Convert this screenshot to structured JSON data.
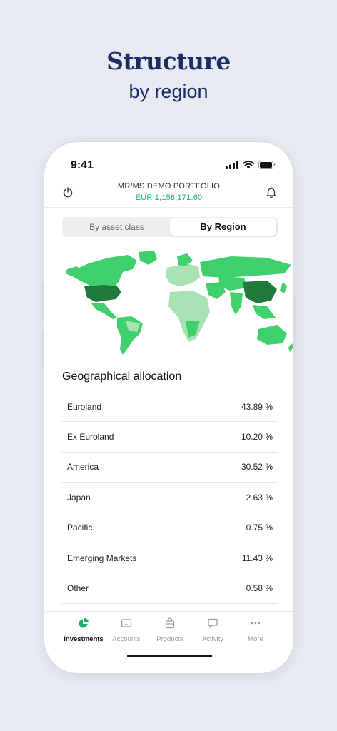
{
  "promo": {
    "title": "Structure",
    "subtitle": "by region"
  },
  "status": {
    "time": "9:41"
  },
  "header": {
    "portfolio_name": "MR/MS DEMO PORTFOLIO",
    "portfolio_value": "EUR 1,158,171.60"
  },
  "segments": [
    {
      "label": "By asset class",
      "selected": false
    },
    {
      "label": "By Region",
      "selected": true
    }
  ],
  "section_title": "Geographical allocation",
  "allocations": [
    {
      "region": "Euroland",
      "value": "43.89 %"
    },
    {
      "region": "Ex Euroland",
      "value": "10.20 %"
    },
    {
      "region": "America",
      "value": "30.52 %"
    },
    {
      "region": "Japan",
      "value": "2.63 %"
    },
    {
      "region": "Pacific",
      "value": "0.75 %"
    },
    {
      "region": "Emerging Markets",
      "value": "11.43 %"
    },
    {
      "region": "Other",
      "value": "0.58 %"
    }
  ],
  "tabs": [
    {
      "label": "Investments",
      "icon": "pie-chart-icon",
      "active": true
    },
    {
      "label": "Accounts",
      "icon": "wallet-icon",
      "active": false
    },
    {
      "label": "Products",
      "icon": "bag-icon",
      "active": false
    },
    {
      "label": "Activity",
      "icon": "chat-icon",
      "active": false
    },
    {
      "label": "More",
      "icon": "more-icon",
      "active": false
    }
  ],
  "colors": {
    "accent": "#19b46a",
    "brand": "#1c2c66",
    "map_light": "#a8e2b4",
    "map_mid": "#3fcf6d",
    "map_dark": "#1f7a3c"
  }
}
